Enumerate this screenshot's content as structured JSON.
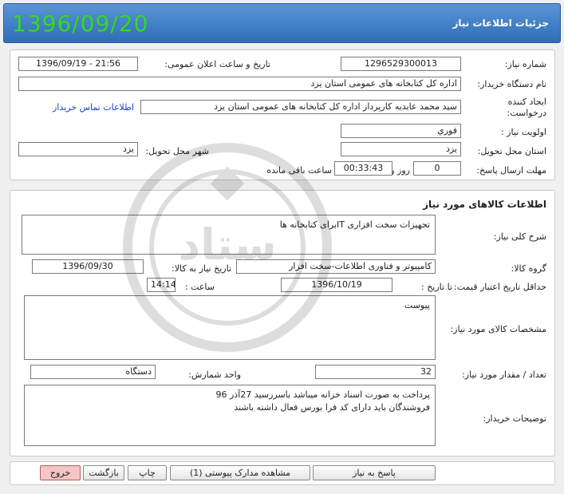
{
  "header": {
    "title": "جزئیات اطلاعات نیاز",
    "date": "1396/09/20"
  },
  "labels": {
    "need_number": "شماره نیاز:",
    "announce_datetime": "تاریخ و ساعت اعلان عمومی:",
    "buyer_org": "نام دستگاه خریدار:",
    "requester_1": "ایجاد کننده",
    "requester_2": "درخواست:",
    "priority": "اولویت نیاز :",
    "delivery_province": "استان محل تحویل:",
    "delivery_city": "شهر محل تحویل:",
    "deadline": "مهلت ارسال پاسخ:",
    "day_and": "روز و",
    "time_remaining": "ساعت باقی مانده",
    "goods_section": "اطلاعات کالاهای مورد نیاز",
    "general_desc": "شرح کلی نیاز:",
    "goods_group": "گروه کالا:",
    "need_date": "تاریخ نیاز به کالا:",
    "min_price_validity": "حداقل تاریخ اعتبار قیمت:",
    "until_date": "تا تاریخ :",
    "hour": "ساعت :",
    "goods_specs": "مشخصات کالای مورد نیاز:",
    "qty": "تعداد / مقدار مورد نیاز:",
    "unit": "واحد شمارش:",
    "buyer_notes": "توضیحات خریدار:"
  },
  "values": {
    "need_number": "1296529300013",
    "announce_datetime": "1396/09/19 - 21:56",
    "buyer_org": "اداره کل کتابخانه های عمومی استان یزد",
    "requester": "سید محمد عابدیه کارپرداز اداره کل کتابخانه های عمومی استان یزد",
    "contact_link": "اطلاعات تماس خریدار",
    "priority": "فوري",
    "delivery_province": "یزد",
    "delivery_city": "یزد",
    "deadline_days": "0",
    "deadline_time": "00:33:43",
    "general_desc": "تجهیزات سخت افزاری ITبرای کتابخانه ها",
    "goods_group": "کامپیوتر و فناوری اطلاعات-سخت افزار",
    "need_date": "1396/09/30",
    "until_date": "1396/10/19",
    "hour": "14:14",
    "goods_specs": "پیوست",
    "qty": "32",
    "unit": "دستگاه",
    "buyer_notes_line1": "پرداخت به صورت اسناد خزانه میباشد باسررسید 27آذر 96",
    "buyer_notes_line2": "فروشندگان باید دارای کد فرا بورس فعال داشته باشند"
  },
  "buttons": {
    "reply": "پاسخ به نیاز",
    "view_docs": "مشاهده مدارک پیوستی (1)",
    "print": "چاپ",
    "back": "بازگشت",
    "exit": "خروج"
  },
  "watermark": {
    "line1": "مرکز فناوری اطلاعات و ارتباطات",
    "logo_text": "ستاد"
  }
}
